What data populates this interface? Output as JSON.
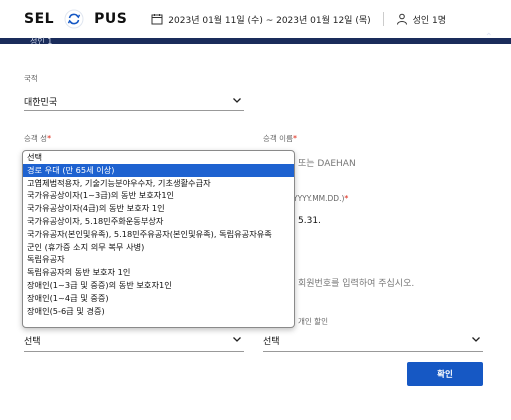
{
  "header": {
    "origin": "SEL",
    "destination": "PUS",
    "dates": "2023년 01월 11일 (수) ~ 2023년 01월 12일 (목)",
    "passengers": "성인 1명",
    "panel_title": "성인 1"
  },
  "form": {
    "nationality_label": "국적",
    "nationality_value": "대한민국",
    "surname_label": "승객 성",
    "name_label": "승객 이름",
    "name_placeholder": "또는 DAEHAN",
    "birth_label": "YYYY.MM.DD.)",
    "birth_value": "5.31.",
    "member_placeholder": "회원번호를 입력하여 주십시오.",
    "discount_label": "개인 할인",
    "left_select_value": "선택",
    "right_select_value": "선택",
    "confirm_label": "확인"
  },
  "dropdown": {
    "selected_index": 1,
    "options": [
      "선택",
      "경로 우대 (만 65세 이상)",
      "고엽제법적용자, 기술기능분야우수자, 기초생활수급자",
      "국가유공상이자(1~3급)의 동반 보호자1인",
      "국가유공상이자(4급)의 동반 보호자 1인",
      "국가유공상이자, 5.18민주화운동부상자",
      "국가유공자(본인및유족), 5.18민주유공자(본인및유족), 독립유공자유족",
      "군인 (휴가증 소지 의무 복무 사병)",
      "독립유공자",
      "독립유공자의 동반 보호자 1인",
      "장애인(1~3급 및 중증)의 동반 보호자1인",
      "장애인(1~4급 및 중증)",
      "장애인(5-6급 및 경증)"
    ]
  },
  "colors": {
    "navy": "#1a2c5b",
    "selection": "#1e62d0",
    "button": "#1658c4",
    "required": "#dd1111"
  }
}
